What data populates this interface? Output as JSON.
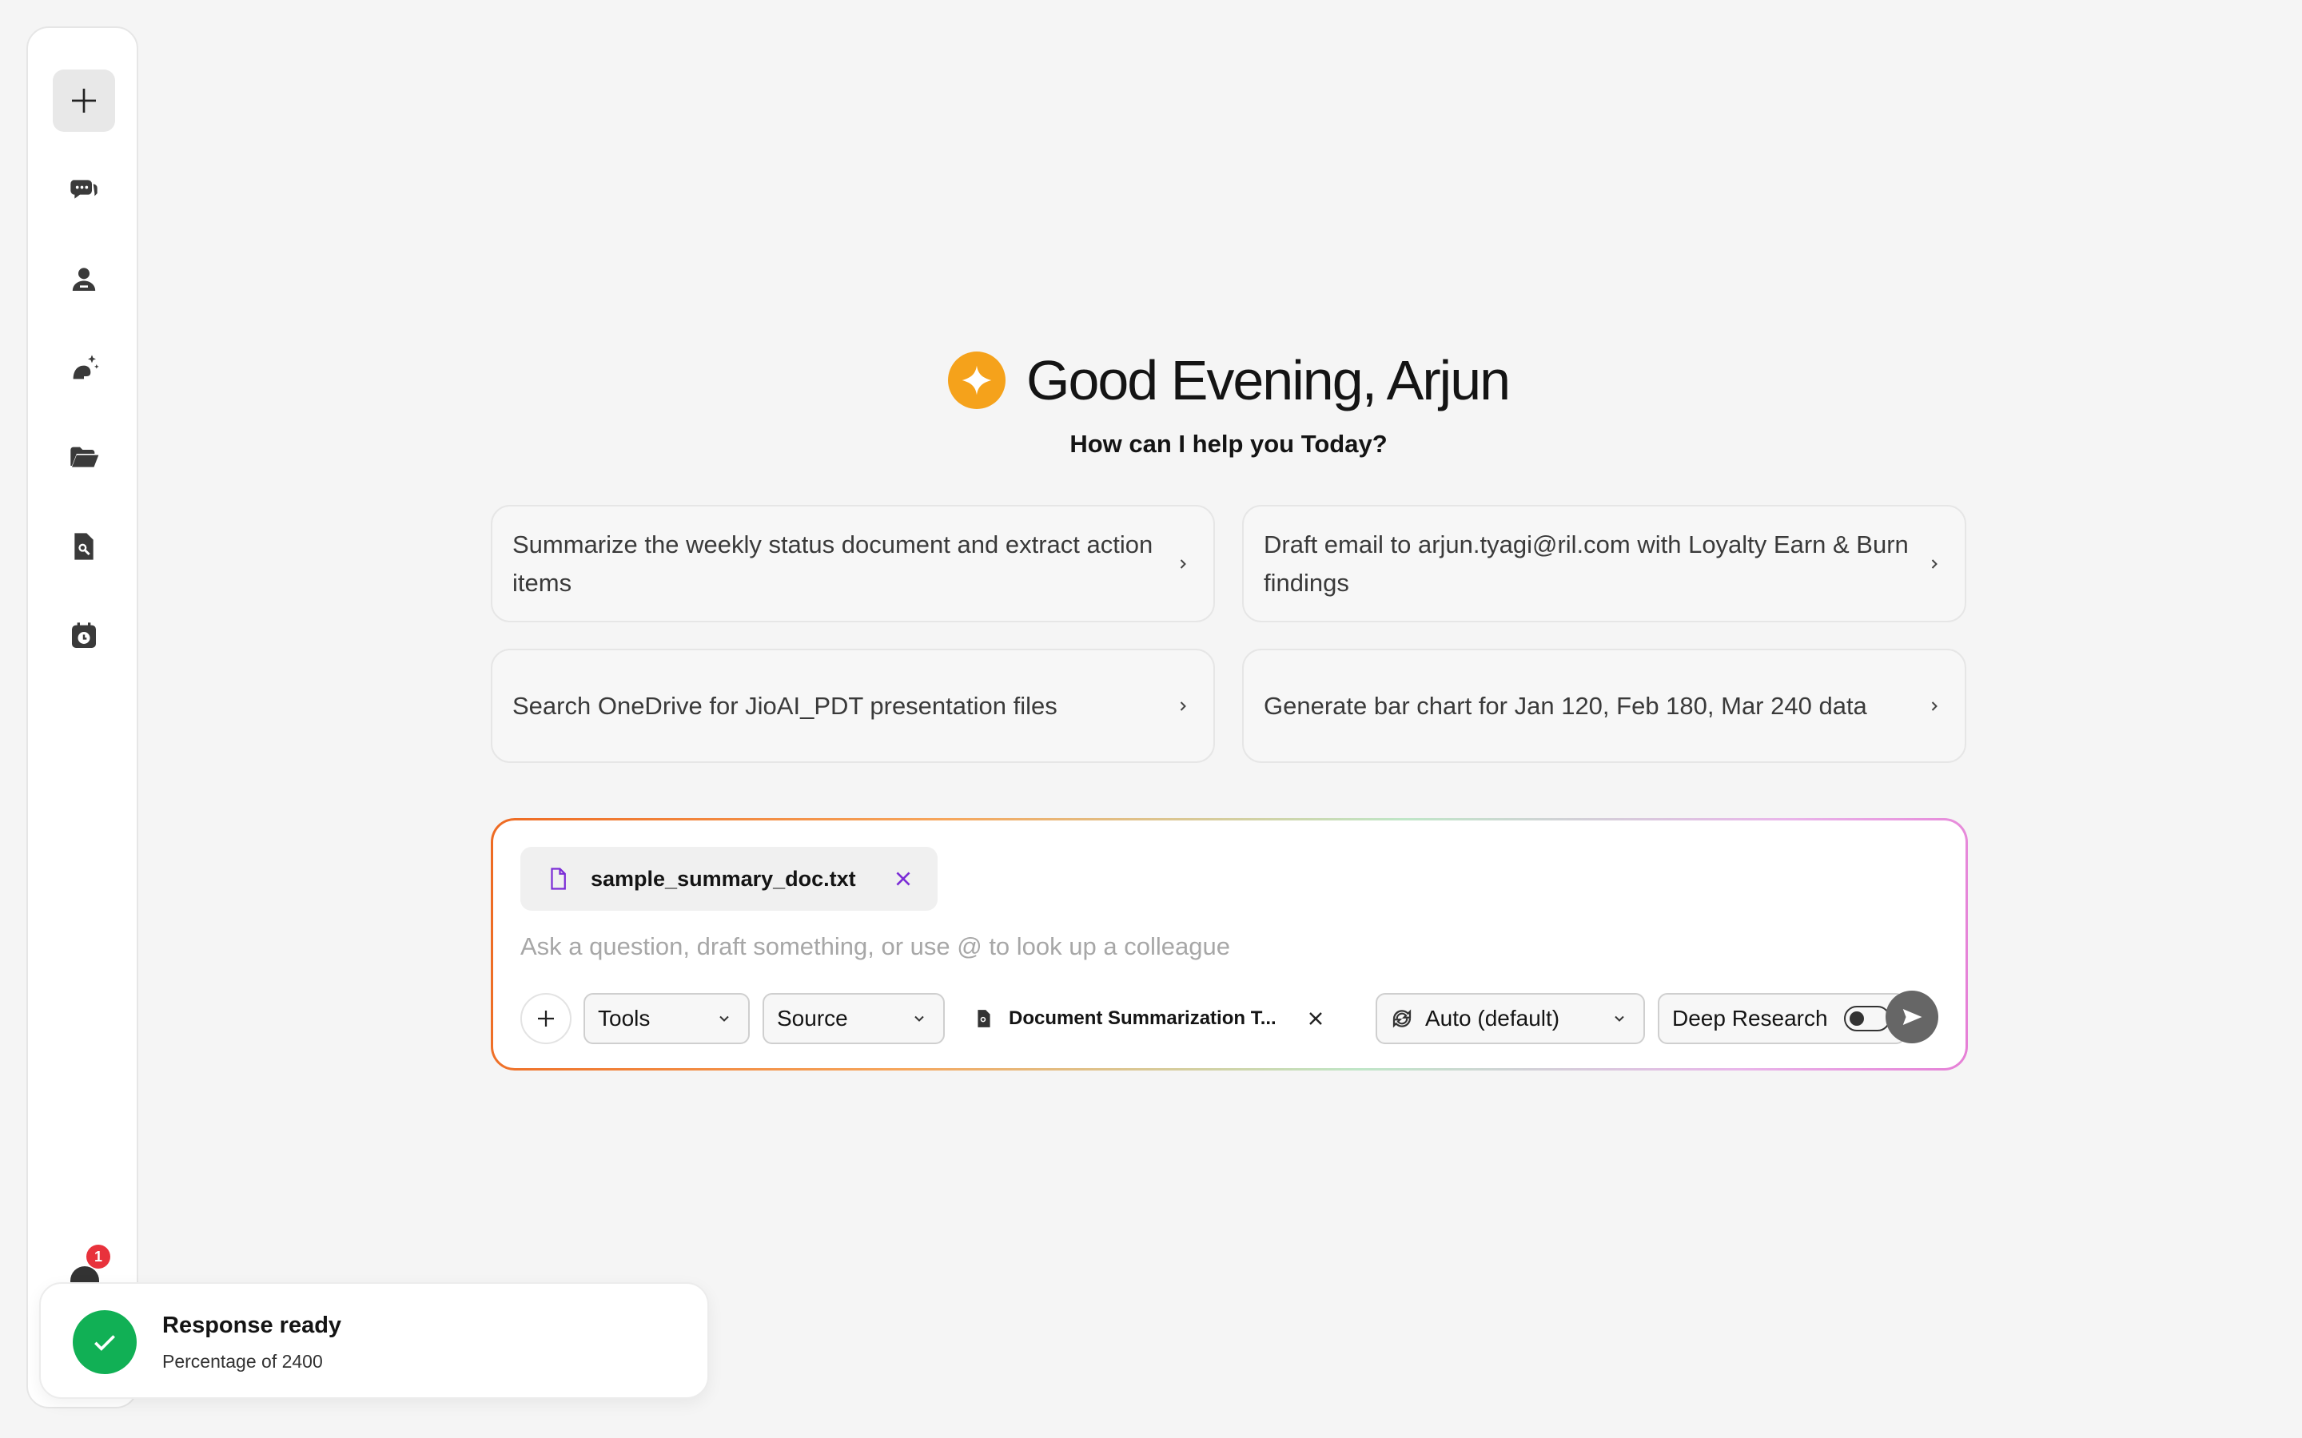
{
  "sidebar": {
    "items": [
      {
        "icon": "plus-icon",
        "active": true
      },
      {
        "icon": "chat-bubbles-icon"
      },
      {
        "icon": "user-icon"
      },
      {
        "icon": "sparkle-agent-icon"
      },
      {
        "icon": "folder-open-icon"
      },
      {
        "icon": "document-search-icon"
      },
      {
        "icon": "calendar-clock-icon"
      }
    ],
    "notification_count": "1"
  },
  "greeting": {
    "title": "Good Evening, Arjun",
    "subtitle": "How can I help you Today?"
  },
  "suggestions": [
    {
      "text": "Summarize the weekly status document and extract action items"
    },
    {
      "text": "Draft email to arjun.tyagi@ril.com with Loyalty Earn & Burn findings"
    },
    {
      "text": "Search OneDrive for JioAI_PDT presentation files"
    },
    {
      "text": "Generate bar chart for Jan 120, Feb 180, Mar 240 data"
    }
  ],
  "composer": {
    "attachment": {
      "name": "sample_summary_doc.txt"
    },
    "placeholder": "Ask a question, draft something, or use @ to look up a colleague",
    "tools_label": "Tools",
    "source_label": "Source",
    "active_tool": "Document Summarization T...",
    "model_label": "Auto (default)",
    "deep_research_label": "Deep Research",
    "deep_research_enabled": false
  },
  "toast": {
    "title": "Response ready",
    "subtitle": "Percentage of 2400"
  },
  "colors": {
    "accent_orange": "#f5a21b",
    "success_green": "#11b055",
    "badge_red": "#e8323c",
    "attachment_purple": "#7b2cd6"
  }
}
